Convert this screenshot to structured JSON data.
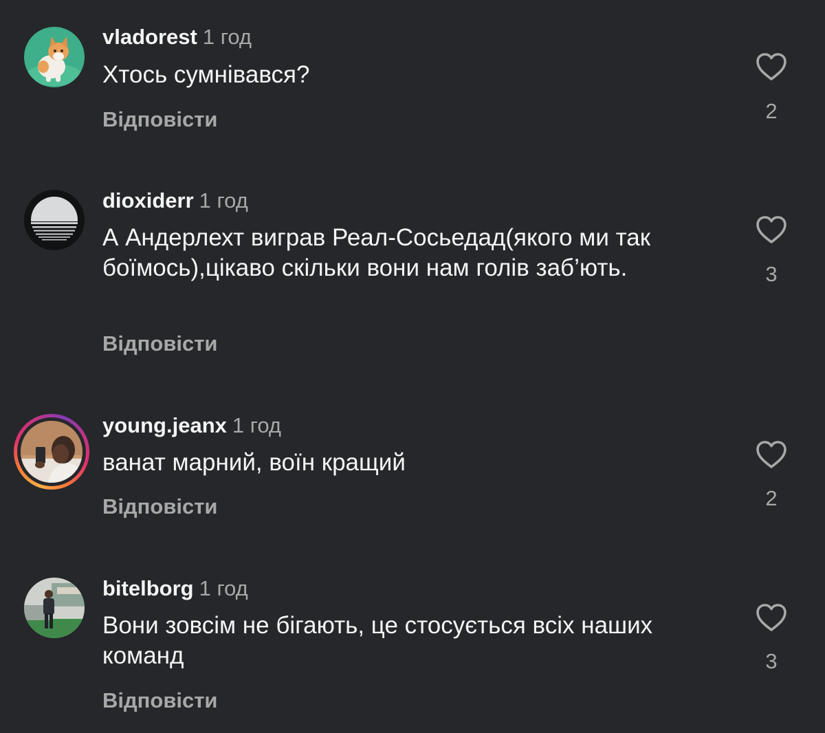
{
  "comments": [
    {
      "username": "vladorest",
      "time": "1 год",
      "text": "Хтось сумнівався?",
      "reply_label": "Відповісти",
      "likes": "2",
      "avatar_icon": "kitten-photo"
    },
    {
      "username": "dioxiderr",
      "time": "1 год",
      "text": "А Андерлехт виграв Реал-Сосьедад(якого ми так боїмось),цікаво скільки вони нам голів заб’ють.",
      "reply_label": "Відповісти",
      "likes": "3",
      "avatar_icon": "striped-circle-logo"
    },
    {
      "username": "young.jeanx",
      "time": "1 год",
      "text": "ванат марний, воїн кращий",
      "reply_label": "Відповісти",
      "likes": "2",
      "avatar_icon": "person-selfie-photo",
      "has_story": true
    },
    {
      "username": "bitelborg",
      "time": "1 год",
      "text": "Вони зовсім не бігають, це стосується всіх наших команд",
      "reply_label": "Відповісти",
      "likes": "3",
      "avatar_icon": "person-standing-photo"
    }
  ],
  "colors": {
    "background": "#25272b",
    "primary_text": "#f5f5f5",
    "secondary_text": "#a8a8a8"
  }
}
